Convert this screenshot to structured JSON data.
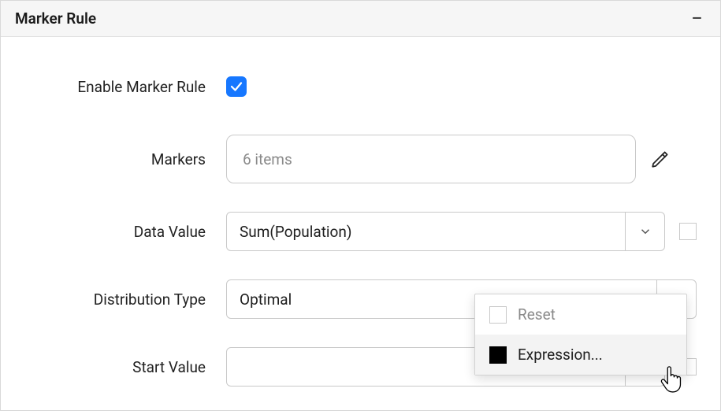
{
  "panel": {
    "title": "Marker Rule"
  },
  "form": {
    "enable": {
      "label": "Enable Marker Rule",
      "checked": true
    },
    "markers": {
      "label": "Markers",
      "placeholder": "6 items"
    },
    "dataValue": {
      "label": "Data Value",
      "value": "Sum(Population)"
    },
    "distributionType": {
      "label": "Distribution Type",
      "value": "Optimal"
    },
    "startValue": {
      "label": "Start Value",
      "value": ""
    }
  },
  "popup": {
    "reset": "Reset",
    "expression": "Expression..."
  }
}
